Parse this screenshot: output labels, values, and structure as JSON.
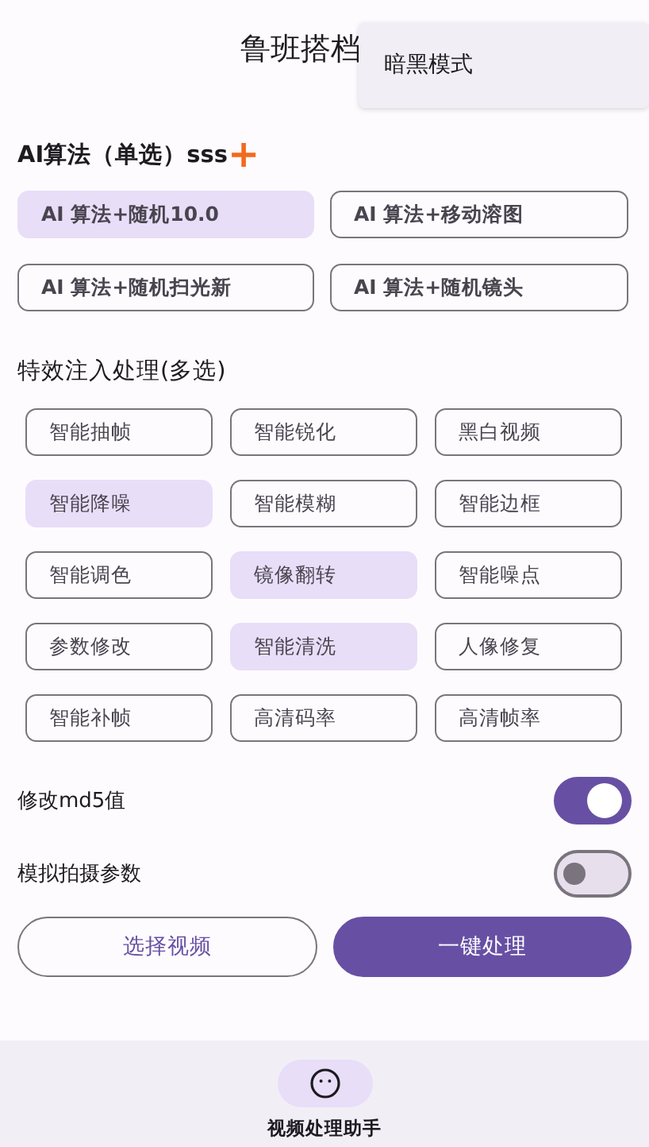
{
  "app_bar": {
    "title": "鲁班搭档"
  },
  "menu": {
    "items": [
      {
        "label": "暗黑模式"
      }
    ]
  },
  "algorithms": {
    "heading": "AI算法（单选）sss",
    "add_icon": "+",
    "options": [
      {
        "label": "AI 算法+随机10.0",
        "selected": true
      },
      {
        "label": "AI 算法+移动溶图",
        "selected": false
      },
      {
        "label": "AI 算法+随机扫光新",
        "selected": false
      },
      {
        "label": "AI 算法+随机镜头",
        "selected": false
      }
    ]
  },
  "effects": {
    "heading": "特效注入处理(多选)",
    "options": [
      {
        "label": "智能抽帧",
        "selected": false
      },
      {
        "label": "智能锐化",
        "selected": false
      },
      {
        "label": "黑白视频",
        "selected": false
      },
      {
        "label": "智能降噪",
        "selected": true
      },
      {
        "label": "智能模糊",
        "selected": false
      },
      {
        "label": "智能边框",
        "selected": false
      },
      {
        "label": "智能调色",
        "selected": false
      },
      {
        "label": "镜像翻转",
        "selected": true
      },
      {
        "label": "智能噪点",
        "selected": false
      },
      {
        "label": "参数修改",
        "selected": false
      },
      {
        "label": "智能清洗",
        "selected": true
      },
      {
        "label": "人像修复",
        "selected": false
      },
      {
        "label": "智能补帧",
        "selected": false
      },
      {
        "label": "高清码率",
        "selected": false
      },
      {
        "label": "高清帧率",
        "selected": false
      }
    ]
  },
  "switches": [
    {
      "label": "修改md5值",
      "on": true
    },
    {
      "label": "模拟拍摄参数",
      "on": false
    }
  ],
  "actions": [
    {
      "label": "选择视频",
      "kind": "outlined"
    },
    {
      "label": "一键处理",
      "kind": "filled"
    }
  ],
  "bottom_nav": {
    "items": [
      {
        "label": "视频处理助手",
        "selected": true
      }
    ]
  }
}
